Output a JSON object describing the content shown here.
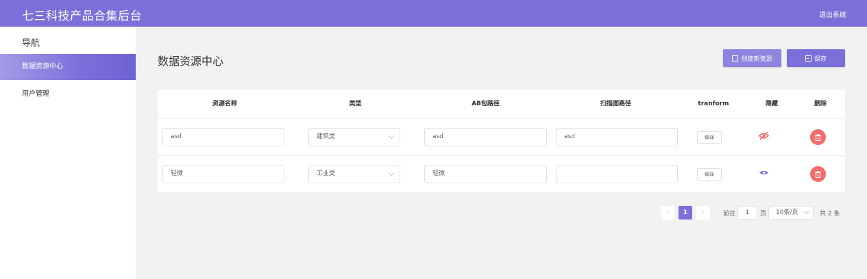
{
  "header": {
    "app_title": "七三科技产品合集后台",
    "logout_label": "退出系统"
  },
  "sidebar": {
    "title": "导航",
    "items": [
      {
        "label": "数据资源中心"
      },
      {
        "label": "用户管理"
      }
    ]
  },
  "page": {
    "title": "数据资源中心",
    "create_button": "创建新资源",
    "save_button": "保存"
  },
  "table": {
    "columns": [
      "资源名称",
      "类型",
      "AB包路径",
      "扫描图路径",
      "tranform",
      "隐藏",
      "删除"
    ],
    "rows": [
      {
        "name": "asd",
        "type": "建筑类",
        "ab_path": "asd",
        "scan_path": "asd",
        "edit_label": "编译",
        "hidden": true
      },
      {
        "name": "轻微",
        "type": "工业类",
        "ab_path": "轻微",
        "scan_path": "",
        "edit_label": "编译",
        "hidden": false
      }
    ]
  },
  "pagination": {
    "prev": "‹",
    "current_page": "1",
    "next": "›",
    "goto_prefix": "前往",
    "goto_value": "1",
    "goto_suffix": "页",
    "page_size": "10条/页",
    "total": "共 2 条"
  },
  "colors": {
    "accent": "#7b70d9",
    "danger": "#f56c6c"
  }
}
